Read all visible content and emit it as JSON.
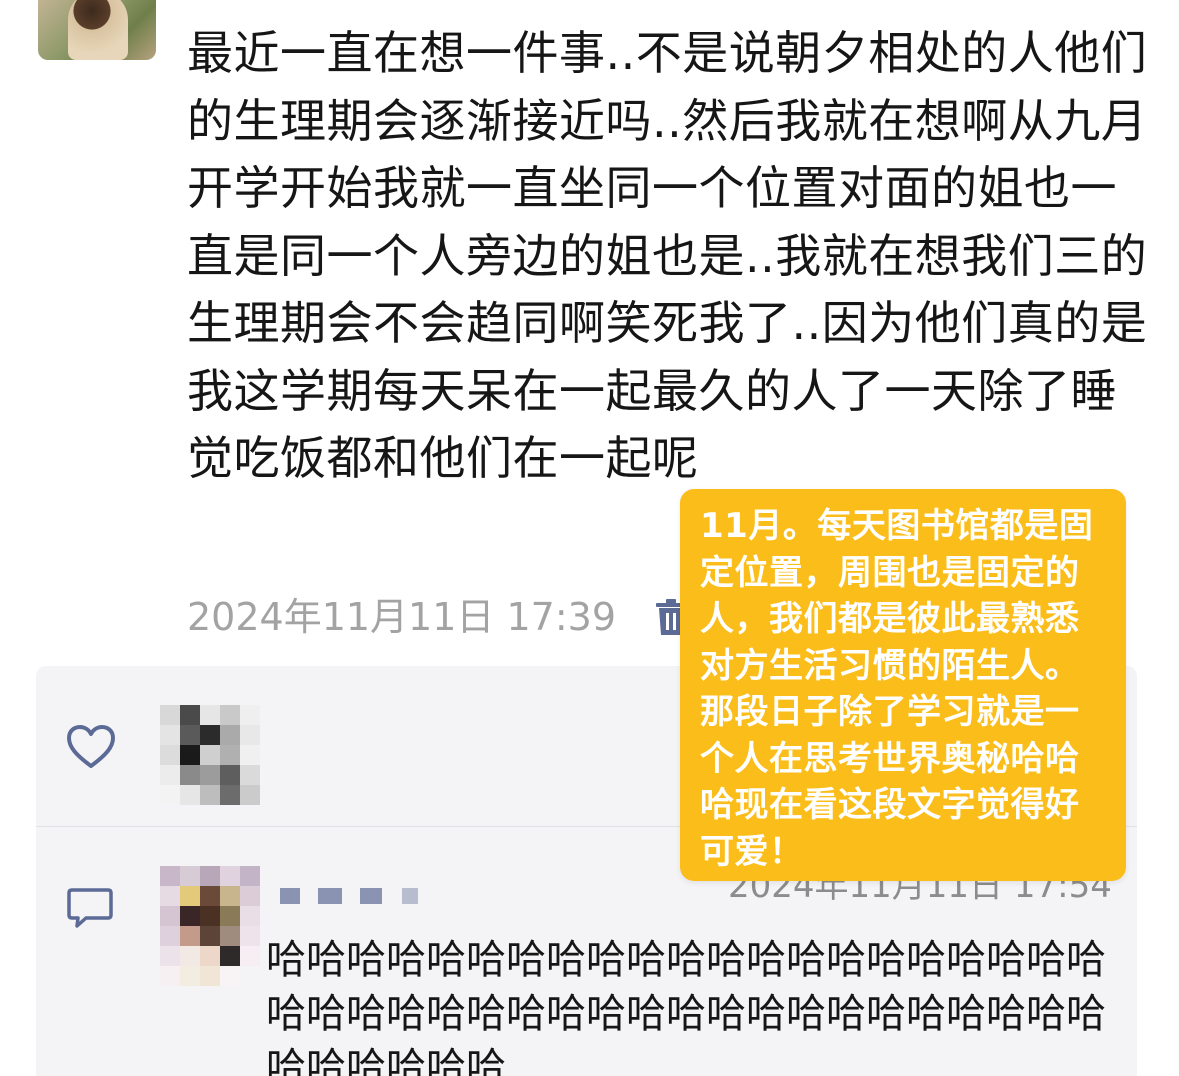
{
  "post": {
    "text": "最近一直在想一件事..不是说朝夕相处的人他们的生理期会逐渐接近吗..然后我就在想啊从九月开学开始我就一直坐同一个位置对面的姐也一直是同一个人旁边的姐也是..我就在想我们三的生理期会不会趋同啊笑死我了..因为他们真的是我这学期每天呆在一起最久的人了一天除了睡觉吃饭都和他们在一起呢",
    "timestamp": "2024年11月11日 17:39",
    "delete_icon": "trash-icon",
    "author_avatar": "avatar-photo"
  },
  "likes": {
    "icon": "heart-icon"
  },
  "comment": {
    "icon": "comment-icon",
    "timestamp": "2024年11月11日 17:54",
    "text": "哈哈哈哈哈哈哈哈哈哈哈哈哈哈哈哈哈哈哈哈哈哈哈哈哈哈哈哈哈哈哈哈哈哈哈哈哈哈哈哈哈哈哈哈哈哈哈哈"
  },
  "annotation": {
    "text": "11月。每天图书馆都是固定位置，周围也是固定的人，我们都是彼此最熟悉对方生活习惯的陌生人。那段日子除了学习就是一个人在思考世界奥秘哈哈哈现在看这段文字觉得好可爱！",
    "background_color": "#fbbd1a",
    "text_color": "#ffffff"
  },
  "colors": {
    "link_blue": "#5c6a96",
    "timestamp_gray": "#a3a3a3",
    "panel_bg": "#f4f4f6"
  }
}
